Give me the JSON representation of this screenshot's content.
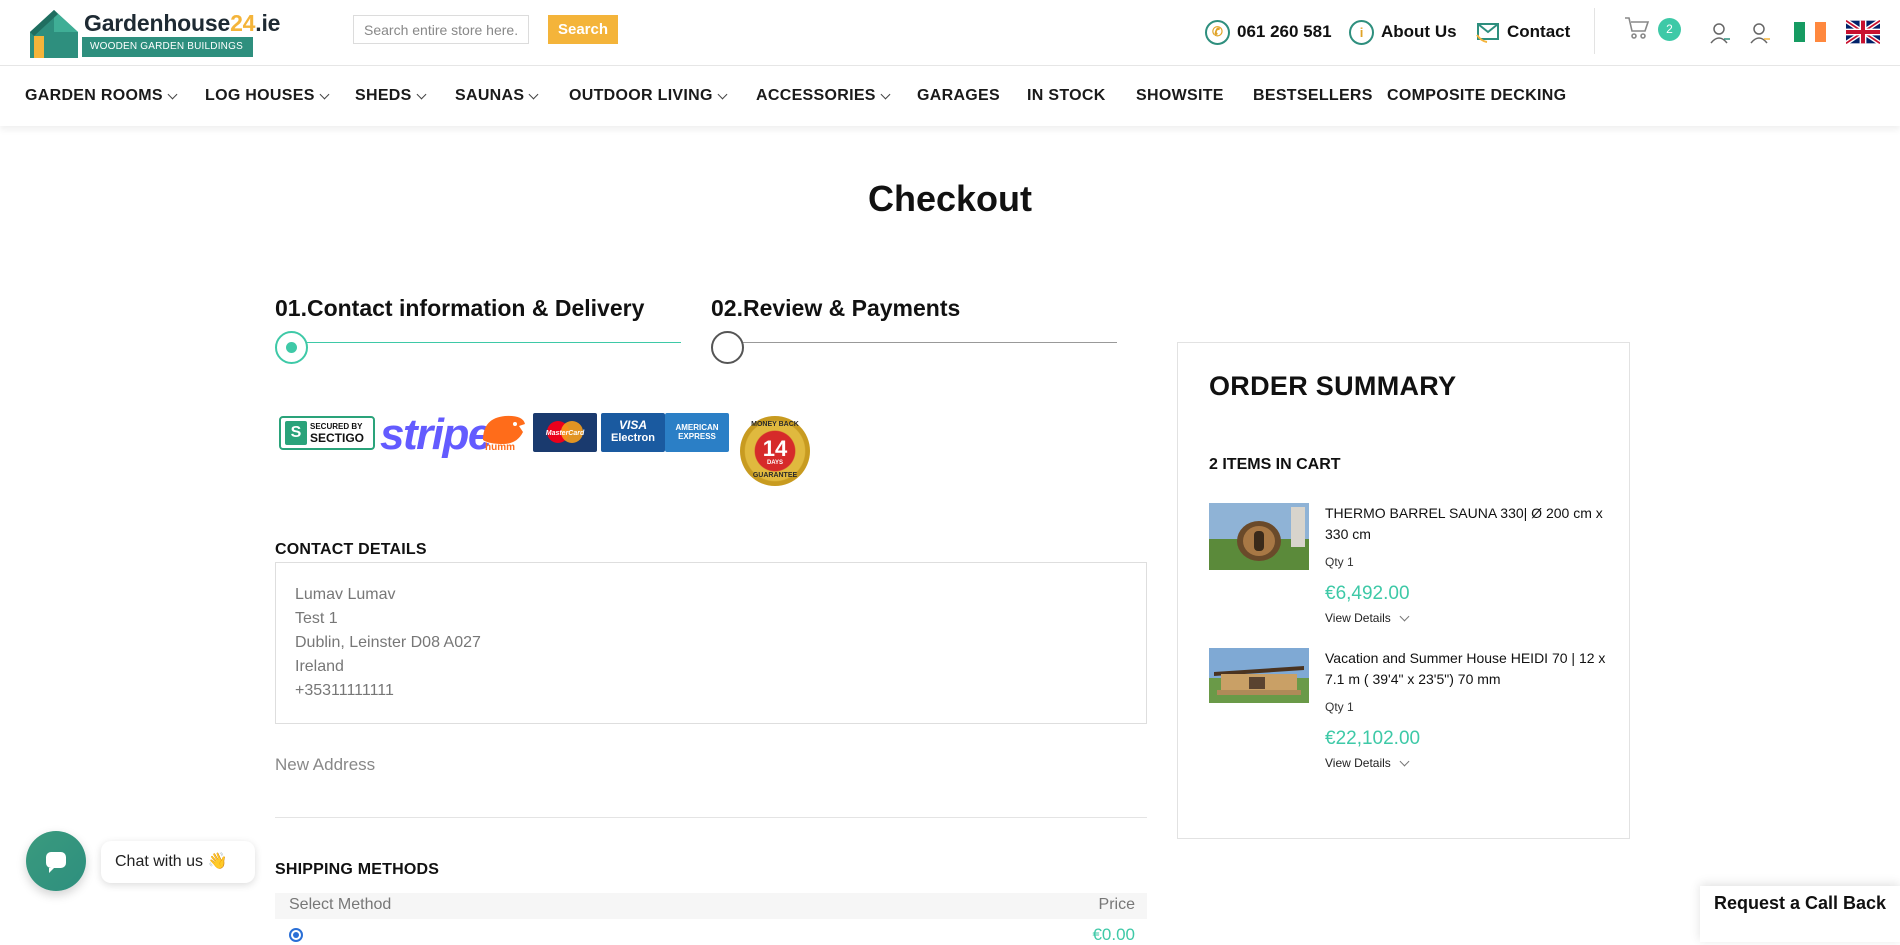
{
  "header": {
    "logo_title_main": "Gardenhouse",
    "logo_title_accent": "24",
    "logo_title_tld": ".ie",
    "logo_subtitle": "WOODEN GARDEN BUILDINGS",
    "search_placeholder": "Search entire store here...",
    "search_button": "Search",
    "phone": "061 260 581",
    "about": "About Us",
    "contact": "Contact",
    "cart_count": "2",
    "icons": [
      "phone-icon",
      "info-icon",
      "contact-icon",
      "cart-icon",
      "user-icon",
      "user-icon",
      "ireland-flag-icon",
      "uk-flag-icon"
    ]
  },
  "nav": [
    {
      "label": "GARDEN ROOMS"
    },
    {
      "label": "LOG HOUSES"
    },
    {
      "label": "SHEDS"
    },
    {
      "label": "SAUNAS"
    },
    {
      "label": "OUTDOOR LIVING"
    },
    {
      "label": "ACCESSORIES"
    },
    {
      "label": "GARAGES"
    },
    {
      "label": "IN STOCK"
    },
    {
      "label": "SHOWSITE"
    },
    {
      "label": "BESTSELLERS"
    },
    {
      "label": "COMPOSITE DECKING"
    }
  ],
  "page": {
    "title": "Checkout"
  },
  "steps": [
    {
      "label": "01.Contact information & Delivery",
      "state": "active"
    },
    {
      "label": "02.Review & Payments",
      "state": "inactive"
    }
  ],
  "badges": {
    "sectigo_top": "SECURED BY",
    "sectigo_main": "SECTIGO",
    "stripe": "stripe",
    "humm": "humm",
    "mastercard": "MasterCard",
    "visa": "VISA",
    "visa_sub": "Electron",
    "amex_1": "AMERICAN",
    "amex_2": "EXPRESS",
    "guarantee_top": "MONEY BACK",
    "guarantee_num": "14",
    "guarantee_days": "DAYS",
    "guarantee_bottom": "GUARANTEE"
  },
  "contact": {
    "heading": "CONTACT DETAILS",
    "address": [
      "Lumav Lumav",
      "Test 1",
      "Dublin, Leinster D08 A027",
      "Ireland",
      "+35311111111"
    ],
    "new_address": "New Address"
  },
  "shipping": {
    "heading": "SHIPPING METHODS",
    "col_method": "Select Method",
    "col_price": "Price",
    "first_price": "€0.00"
  },
  "summary": {
    "title": "ORDER SUMMARY",
    "count_label": "2 ITEMS IN CART",
    "items": [
      {
        "name": "THERMO BARREL SAUNA 330| Ø 200 cm x 330 cm",
        "qty": "Qty 1",
        "price": "€6,492.00",
        "details": "View Details"
      },
      {
        "name": "Vacation and Summer House HEIDI 70 | 12 x 7.1 m ( 39'4\" x 23'5\") 70 mm",
        "qty": "Qty 1",
        "price": "€22,102.00",
        "details": "View Details"
      }
    ]
  },
  "chat": {
    "label": "Chat with us 👋"
  },
  "callback": {
    "label": "Request a Call Back"
  },
  "colors": {
    "accent_green": "#3ec9a7",
    "brand_teal": "#2e8f7e",
    "brand_yellow": "#f4b43a"
  }
}
